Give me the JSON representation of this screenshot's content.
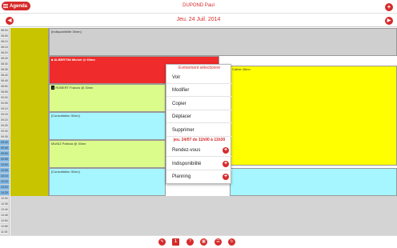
{
  "app": {
    "agenda_label": "Agenda",
    "user": "DUPOND Paul",
    "date": "Jeu. 24 Juil. 2014"
  },
  "times": [
    "08:00",
    "08:05",
    "08:10",
    "08:15",
    "08:20",
    "08:25",
    "08:30",
    "08:35",
    "08:40",
    "08:45",
    "08:50",
    "08:55",
    "09:00",
    "09:05",
    "09:10",
    "09:15",
    "09:20",
    "09:25",
    "09:30",
    "09:35",
    "09:40",
    "09:45",
    "09:50",
    "09:55",
    "10:00",
    "10:05",
    "10:10",
    "10:15",
    "10:20",
    "10:25",
    "10:30",
    "10:35",
    "10:40",
    "10:45",
    "10:50",
    "10:55",
    "11:00"
  ],
  "events": {
    "indispo": "[Indisponibilité 30mn]",
    "albertini": "ALBERTINI Michel @ 60mn",
    "robert": "ROBERT Francis @ 30mn",
    "consult1": "[Consultation 30mn]",
    "muniz": "MUNIZ Patricia @ 30mn",
    "consult2": "[Consultation 30mn]",
    "yellow": "Cathie 45mn",
    "robert_badge": "1"
  },
  "menu": {
    "title": "Evénement sélectionné",
    "voir": "Voir",
    "modifier": "Modifier",
    "copier": "Copier",
    "deplacer": "Déplacer",
    "supprimer": "Supprimer",
    "subtitle": "jeu. 24/07 de 11h00 à 11h30",
    "rdv": "Rendez-vous",
    "indispo": "Indisponibilité",
    "planning": "Planning"
  },
  "bottom": {
    "page": "1"
  },
  "colors": {
    "accent": "#d62a2a",
    "olive": "#c9c400"
  }
}
